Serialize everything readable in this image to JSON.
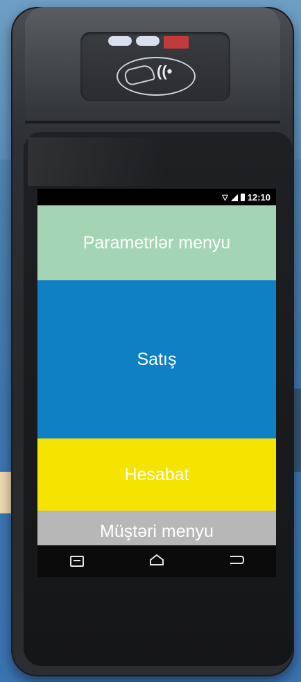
{
  "status": {
    "time": "12:10"
  },
  "menu": {
    "params_label": "Parametrlər menyu",
    "sale_label": "Satış",
    "report_label": "Hesabat",
    "client_label": "Müştəri menyu"
  },
  "colors": {
    "params": "#a3d5b4",
    "sale": "#0f80c4",
    "report": "#f5e300",
    "client": "#b7b7b7"
  },
  "nav": {
    "recent_icon": "recent-apps-icon",
    "home_icon": "home-icon",
    "back_icon": "back-icon"
  }
}
